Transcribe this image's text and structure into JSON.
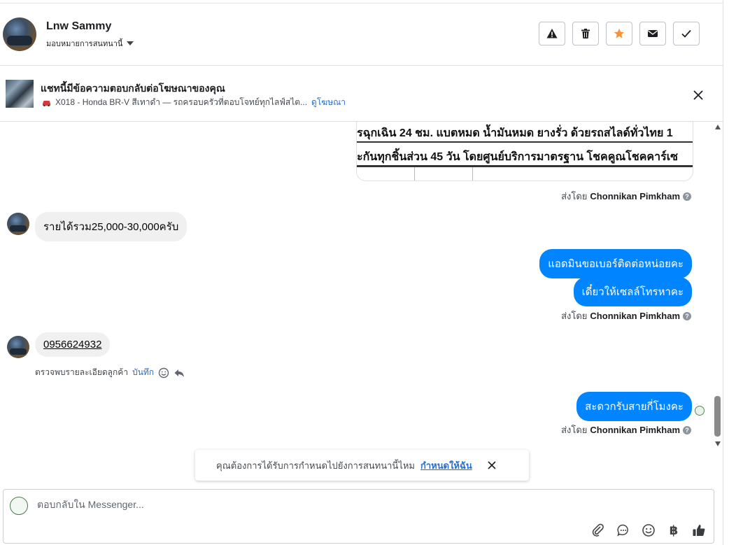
{
  "header": {
    "contact_name": "Lnw Sammy",
    "assign_label": "มอบหมายการสนทนานี้",
    "actions": [
      {
        "icon": "warning-icon"
      },
      {
        "icon": "trash-icon"
      },
      {
        "icon": "star-icon",
        "color": "#f7923b"
      },
      {
        "icon": "envelope-icon"
      },
      {
        "icon": "check-icon"
      }
    ]
  },
  "ad": {
    "title": "แชทนี้มีข้อความตอบกลับต่อโฆษณาของคุณ",
    "subtitle": "X018 - Honda BR-V สีเทาดำ — รถครอบครัวที่ตอบโจทย์ทุกไลฟ์สไต...",
    "view_ad": "ดูโฆษณา"
  },
  "messages": {
    "image_text_1": "รฉุกเฉิน 24 ชม. แบตหมด น้ำมันหมด ยางรั่ว ด้วยรถสไลด์ทั่วไทย 1",
    "image_text_2": "ะกันทุกชิ้นส่วน 45 วัน โดยศูนย์บริการมาตรฐาน โชคคูณโชคคาร์เซ",
    "sent_by_prefix": "ส่งโดย",
    "sender_name": "Chonnikan Pimkham",
    "incoming_1": "รายได้รวม25,000-30,000ครับ",
    "outgoing_1": "แอดมินขอเบอร์ติดต่อหน่อยคะ",
    "outgoing_2": "เดี๋ยวให้เซลล์โทรหาคะ",
    "incoming_phone": "0956624932",
    "detected_text": "ตรวจพบรายละเอียดลูกค้า",
    "save_label": "บันทึก",
    "outgoing_3": "สะดวกรับสายกี่โมงคะ"
  },
  "toast": {
    "text": "คุณต้องการได้รับการกำหนดไปยังการสนทนานี้ไหม",
    "link": "กำหนดให้ฉัน"
  },
  "composer": {
    "placeholder": "ตอบกลับใน Messenger...",
    "baht_symbol": "฿"
  },
  "colors": {
    "accent": "#0084ff",
    "link": "#216fdb",
    "star": "#f7923b"
  }
}
